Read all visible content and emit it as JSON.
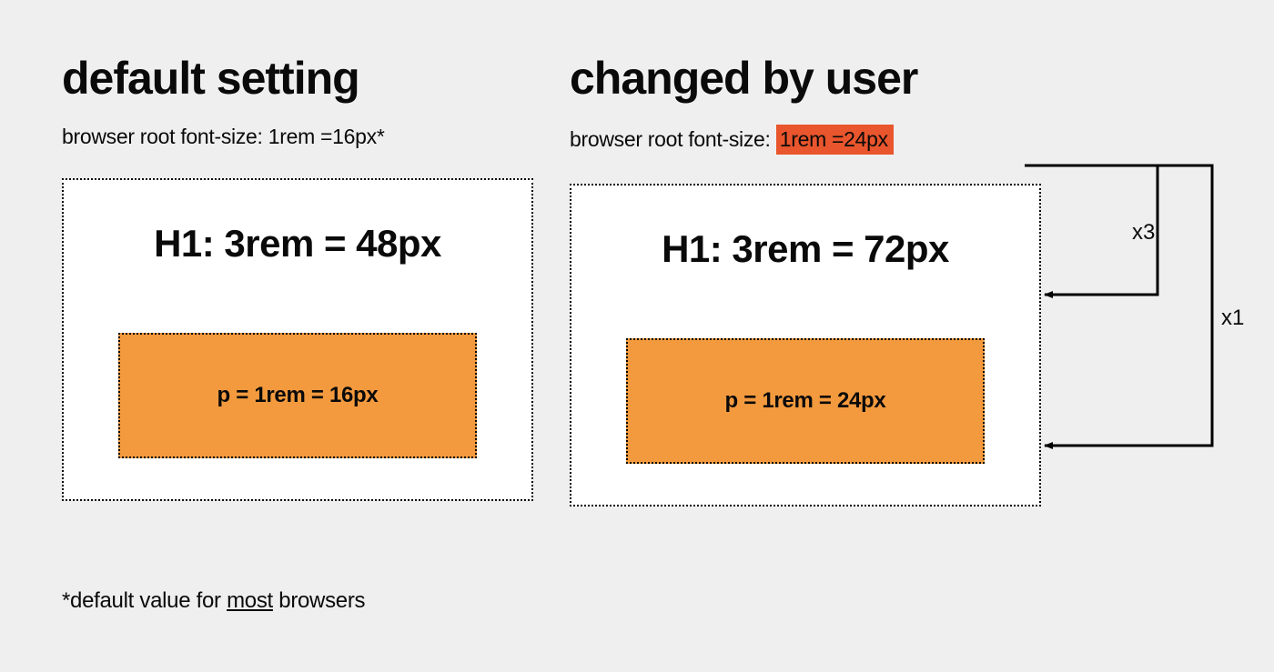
{
  "left": {
    "title": "default setting",
    "sub_prefix": "browser root font-size: ",
    "sub_value": "1rem =16px*",
    "h1": "H1: 3rem = 48px",
    "p": "p = 1rem = 16px"
  },
  "right": {
    "title": "changed by user",
    "sub_prefix": "browser root font-size: ",
    "sub_value": "1rem =24px",
    "h1": "H1: 3rem = 72px",
    "p": "p = 1rem = 24px"
  },
  "multipliers": {
    "h1": "x3",
    "p": "x1"
  },
  "footnote": {
    "pre": "*default value for ",
    "u": "most",
    "post": " browsers"
  }
}
